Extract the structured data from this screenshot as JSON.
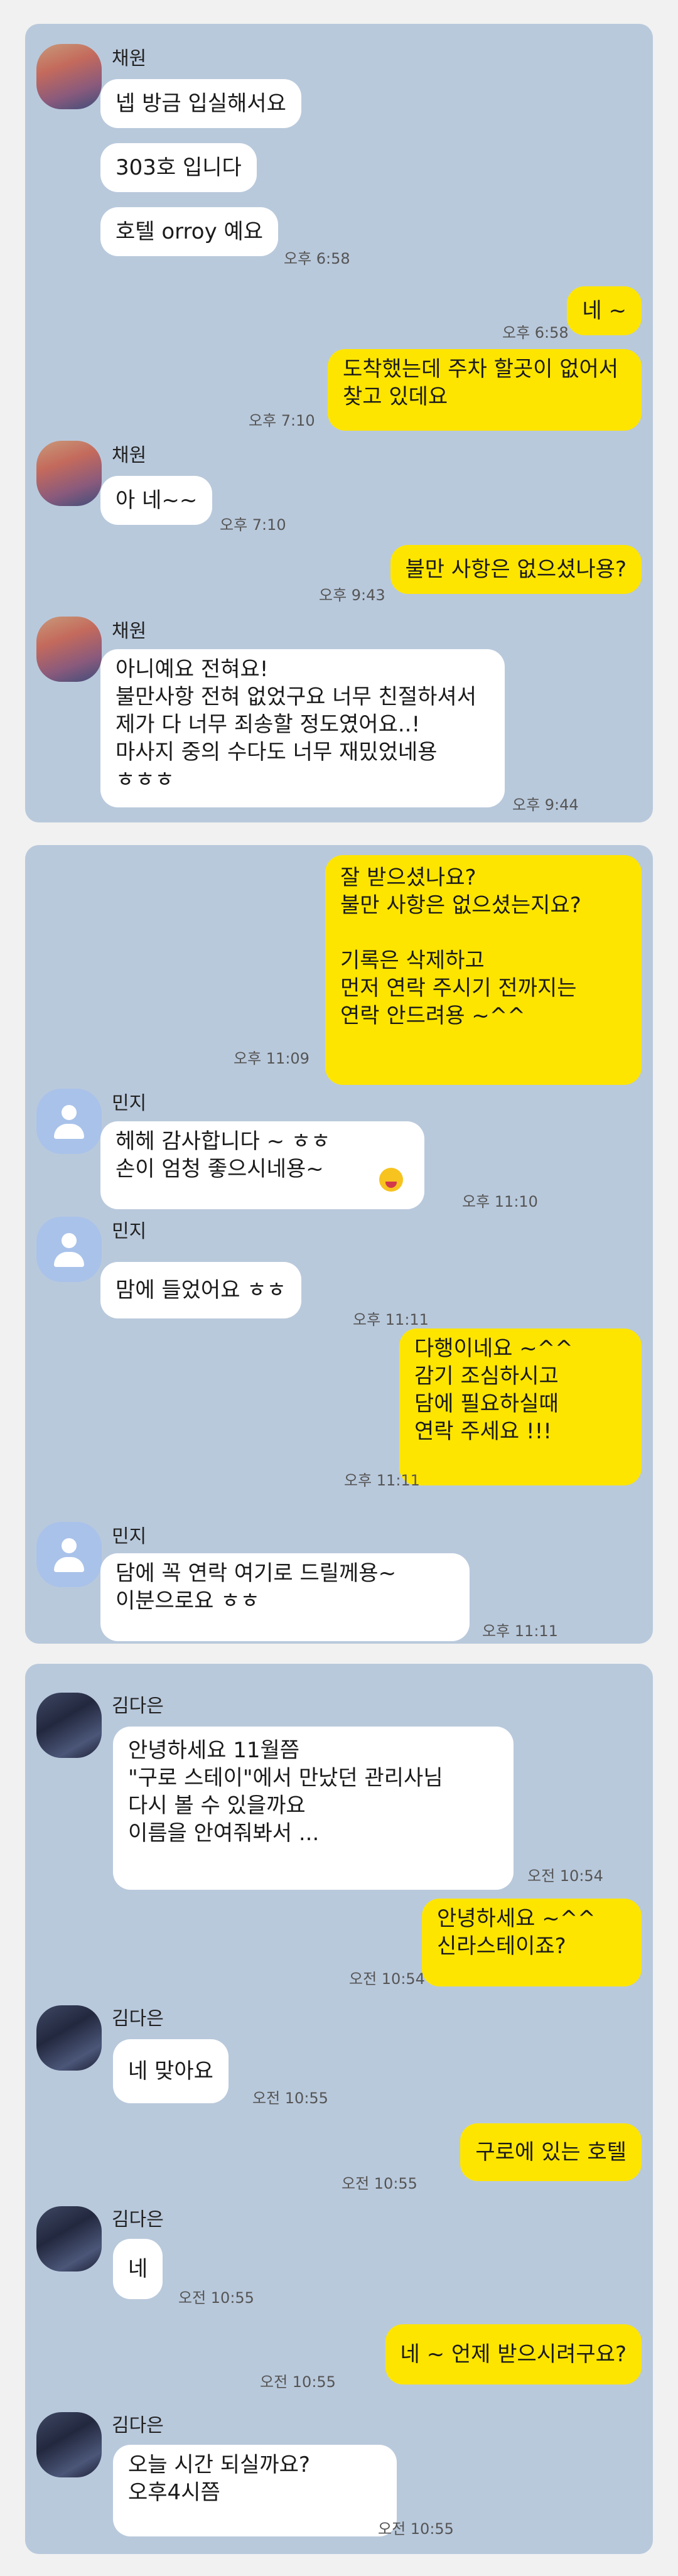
{
  "panel1": {
    "messages": {
      "m1": {
        "text": "넵 방금 입실해서요"
      },
      "m2": {
        "text": "303호 입니다"
      },
      "m3": {
        "text": "호텔 orroy 예요",
        "time": "오후 6:58"
      },
      "m4": {
        "text": "네 ~",
        "time": "오후 6:58"
      },
      "m5": {
        "text": "도착했는데  주차 할곳이 없어서\n찾고 있데요",
        "time": "오후 7:10"
      },
      "m6": {
        "text": "아 네~~",
        "time": "오후 7:10"
      },
      "m7": {
        "text": "불만 사항은 없으셨나용?",
        "time": "오후 9:43"
      },
      "m8": {
        "text": "아니예요 전혀요!\n불만사항 전혀 없었구요 너무 친절하셔서\n제가 다 너무 죄송할 정도였어요..!\n마사지 중의 수다도 너무 재밌었네용\nㅎㅎㅎ",
        "time": "오후 9:44"
      }
    },
    "sender1": "채원",
    "sender2": "채원",
    "sender3": "채원"
  },
  "panel2": {
    "messages": {
      "m1": {
        "text": "잘 받으셨나요?\n불만 사항은 없으셨는지요?\n\n기록은 삭제하고\n먼저 연락 주시기 전까지는\n연락 안드려용 ~^^",
        "time": "오후 11:09"
      },
      "m2": {
        "text": "헤헤 감사합니다 ~ ㅎㅎ\n손이 엄청 좋으시네용~",
        "time": "오후 11:10"
      },
      "m3": {
        "text": "맘에 들었어요 ㅎㅎ",
        "time": "오후 11:11"
      },
      "m4": {
        "text": "다행이네요 ~^^\n감기 조심하시고\n담에 필요하실때\n연락 주세요 !!!",
        "time": "오후 11:11"
      },
      "m5": {
        "text": "담에 꼭 연락 여기로 드릴께용~\n이분으로요 ㅎㅎ",
        "time": "오후 11:11"
      }
    },
    "sender1": "민지",
    "sender2": "민지",
    "sender3": "민지"
  },
  "panel3": {
    "messages": {
      "m1": {
        "text": "안녕하세요 11월쯤\n\"구로 스테이\"에서 만났던 관리사님\n다시 볼 수 있을까요\n이름을 안여줘봐서 ...",
        "time": "오전 10:54"
      },
      "m2": {
        "text": "안녕하세요 ~^^\n신라스테이죠?",
        "time": "오전 10:54"
      },
      "m3": {
        "text": "네 맞아요",
        "time": "오전 10:55"
      },
      "m4": {
        "text": "구로에 있는 호텔",
        "time": "오전 10:55"
      },
      "m5": {
        "text": "네",
        "time": "오전 10:55"
      },
      "m6": {
        "text": "네 ~ 언제 받으시려구요?",
        "time": "오전 10:55"
      },
      "m7": {
        "text": "오늘 시간 되실까요?\n오후4시쯤",
        "time": "오전 10:55"
      }
    },
    "sender1": "김다은",
    "sender2": "김다은",
    "sender3": "김다은",
    "sender4": "김다은"
  }
}
